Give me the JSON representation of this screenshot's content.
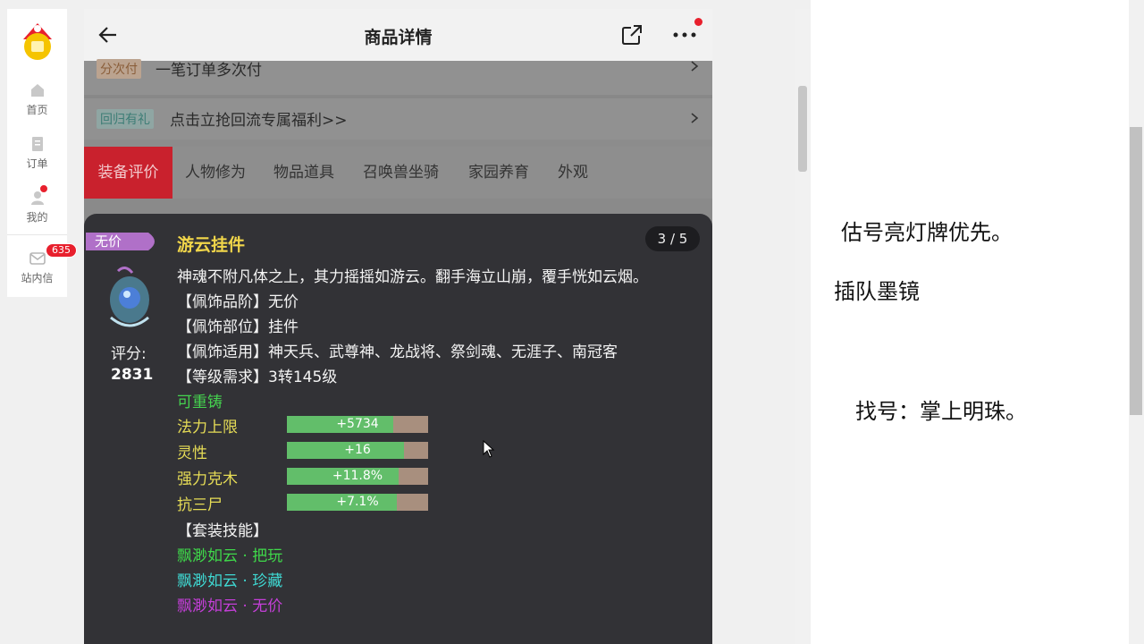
{
  "sidebar": {
    "items": [
      {
        "label": "首页",
        "icon": "home-icon"
      },
      {
        "label": "订单",
        "icon": "order-icon"
      },
      {
        "label": "我的",
        "icon": "user-icon"
      },
      {
        "label": "站内信",
        "icon": "mail-icon"
      }
    ],
    "message_count": "635"
  },
  "navbar": {
    "title": "商品详情"
  },
  "rows": [
    {
      "tag": "分次付",
      "text": "一笔订单多次付"
    },
    {
      "tag": "回归有礼",
      "text": "点击立抢回流专属福利>>"
    }
  ],
  "tabs": [
    "装备评价",
    "人物修为",
    "物品道具",
    "召唤兽坐骑",
    "家园养育",
    "外观"
  ],
  "item": {
    "rarity": "无价",
    "name": "游云挂件",
    "pager": "3 / 5",
    "score_label": "评分:",
    "score_value": "2831",
    "description": "神魂不附凡体之上，其力摇摇如游云。翻手海立山崩，覆手恍如云烟。",
    "attributes": [
      "【佩饰品阶】无价",
      "【佩饰部位】挂件",
      "【佩饰适用】神天兵、武尊神、龙战将、祭剑魂、无涯子、南冠客",
      "【等级需求】3转145级"
    ],
    "recastable": "可重铸",
    "stats": [
      {
        "name": "法力上限",
        "value": "+5734",
        "fill_percent": 75
      },
      {
        "name": "灵性",
        "value": "+16",
        "fill_percent": 83
      },
      {
        "name": "强力克木",
        "value": "+11.8%",
        "fill_percent": 79
      },
      {
        "name": "抗三尸",
        "value": "+7.1%",
        "fill_percent": 78
      }
    ],
    "set_title": "【套装技能】",
    "set_skills": [
      {
        "text": "飘渺如云 · 把玩",
        "color": "#3fd84a"
      },
      {
        "text": "飘渺如云 · 珍藏",
        "color": "#3fd8d2"
      },
      {
        "text": "飘渺如云 · 无价",
        "color": "#c43fd8"
      }
    ]
  },
  "doc": {
    "line1": "估号亮灯牌优先。",
    "line2": "插队墨镜",
    "line3": "找号：掌上明珠。"
  },
  "colors": {
    "accent": "#c9212d",
    "popup_bg": "#323236",
    "gold": "#e6dc56",
    "green": "#45d24f"
  }
}
